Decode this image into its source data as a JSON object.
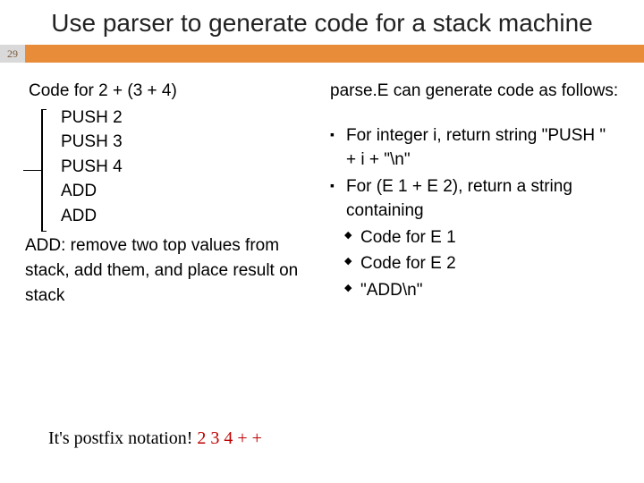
{
  "pagenum": "29",
  "title": "Use parser to generate code for a stack machine",
  "left": {
    "code_title": "Code for 2 + (3 + 4)",
    "lines": [
      "PUSH 2",
      "PUSH 3",
      "PUSH 4",
      "ADD",
      "ADD"
    ],
    "add_desc": "ADD: remove two top values from stack, add them, and place result on stack"
  },
  "right": {
    "intro": "parse.E can generate code as follows:",
    "b1": "For integer i, return string \"PUSH \" + i + \"\\n\"",
    "b2": "For (E 1 + E 2), return a string containing",
    "s1": "Code for E 1",
    "s2": "Code for E 2",
    "s3": "\"ADD\\n\""
  },
  "footer": {
    "prefix": "It's postfix notation!  ",
    "expr": "2  3  4  +  +"
  }
}
